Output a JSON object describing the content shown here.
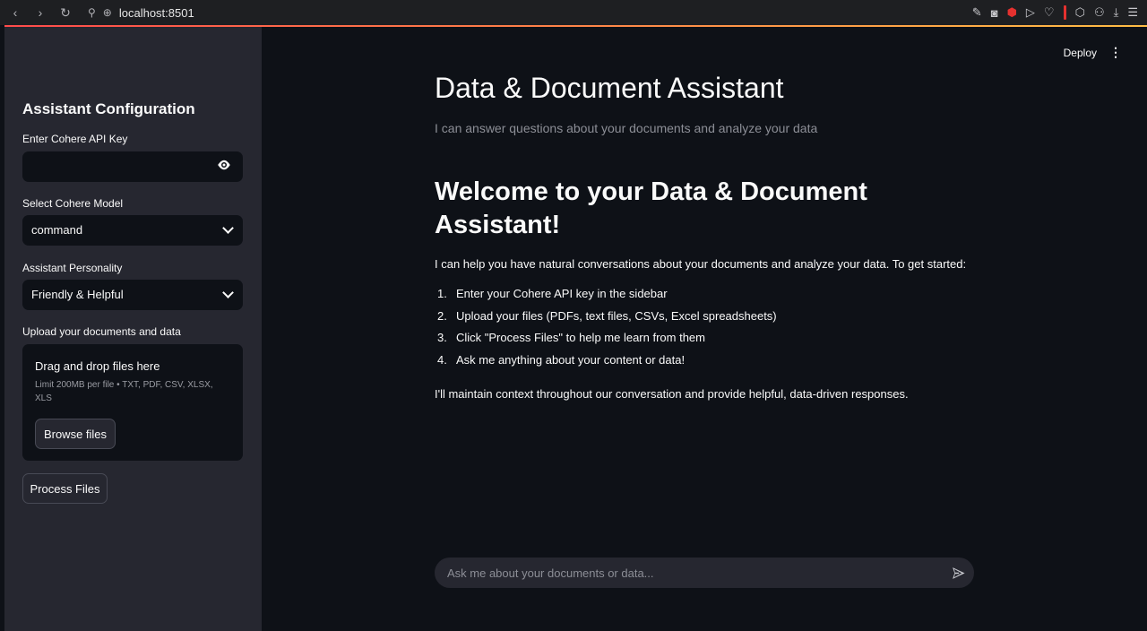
{
  "browser": {
    "url": "localhost:8501"
  },
  "header": {
    "deploy_label": "Deploy"
  },
  "sidebar": {
    "title": "Assistant Configuration",
    "api_key_label": "Enter Cohere API Key",
    "api_key_value": "",
    "model_label": "Select Cohere Model",
    "model_value": "command",
    "personality_label": "Assistant Personality",
    "personality_value": "Friendly & Helpful",
    "upload_label": "Upload your documents and data",
    "dropzone_title": "Drag and drop files here",
    "dropzone_limit": "Limit 200MB per file • TXT, PDF, CSV, XLSX, XLS",
    "browse_label": "Browse files",
    "process_label": "Process Files"
  },
  "main": {
    "title": "Data & Document Assistant",
    "caption": "I can answer questions about your documents and analyze your data",
    "welcome_heading": "Welcome to your Data & Document Assistant!",
    "intro": "I can help you have natural conversations about your documents and analyze your data. To get started:",
    "steps": [
      {
        "num": "1.",
        "text": "Enter your Cohere API key in the sidebar"
      },
      {
        "num": "2.",
        "text": "Upload your files (PDFs, text files, CSVs, Excel spreadsheets)"
      },
      {
        "num": "3.",
        "text": "Click \"Process Files\" to help me learn from them"
      },
      {
        "num": "4.",
        "text": "Ask me anything about your content or data!"
      }
    ],
    "outro": "I'll maintain context throughout our conversation and provide helpful, data-driven responses."
  },
  "chat": {
    "placeholder": "Ask me about your documents or data..."
  },
  "colors": {
    "accent_start": "#ff4b4b",
    "accent_end": "#ffbd45",
    "sidebar_bg": "#262730",
    "main_bg": "#0e1117"
  }
}
